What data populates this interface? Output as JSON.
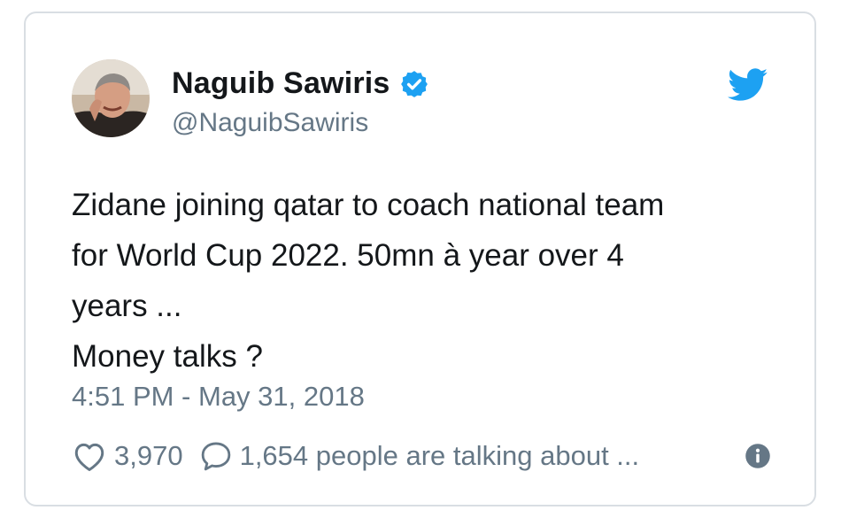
{
  "tweet": {
    "author_name": "Naguib Sawiris",
    "handle": "@NaguibSawiris",
    "text_lines": [
      "Zidane joining qatar to coach national team",
      "for World Cup 2022. 50mn à year over 4",
      "years ...",
      "Money talks ?"
    ],
    "timestamp": "4:51 PM - May 31, 2018",
    "likes": "3,970",
    "talking": "1,654 people are talking about ..."
  },
  "icons": {
    "avatar": "profile-photo",
    "verified": "verified-badge-icon",
    "brand": "twitter-bird-icon",
    "like": "heart-icon",
    "reply": "speech-bubble-icon",
    "info": "info-icon"
  },
  "colors": {
    "accent": "#1da1f2",
    "text": "#14171a",
    "muted": "#657786",
    "border": "#d9dee3"
  }
}
